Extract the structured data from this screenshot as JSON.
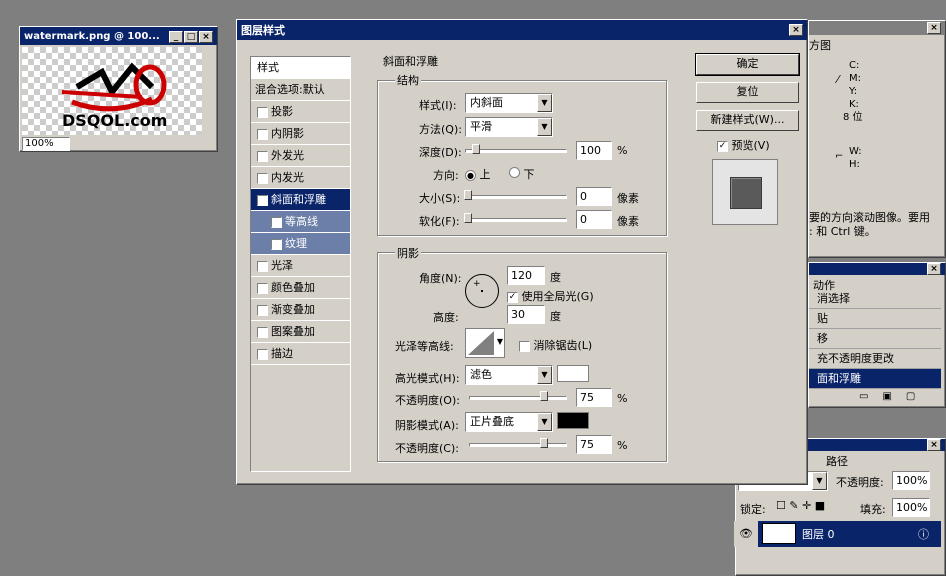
{
  "doc_window": {
    "title": "watermark.png @ 100...",
    "logo_text": "DSQOL.com",
    "zoom": "100%"
  },
  "dialog": {
    "title": "图层样式",
    "styles_header": "样式",
    "blend_options": "混合选项:默认",
    "styles": [
      {
        "label": "投影",
        "checked": false
      },
      {
        "label": "内阴影",
        "checked": false
      },
      {
        "label": "外发光",
        "checked": false
      },
      {
        "label": "内发光",
        "checked": false
      },
      {
        "label": "斜面和浮雕",
        "checked": true
      },
      {
        "label": "等高线",
        "checked": false
      },
      {
        "label": "纹理",
        "checked": false
      },
      {
        "label": "光泽",
        "checked": false
      },
      {
        "label": "颜色叠加",
        "checked": false
      },
      {
        "label": "渐变叠加",
        "checked": false
      },
      {
        "label": "图案叠加",
        "checked": false
      },
      {
        "label": "描边",
        "checked": false
      }
    ],
    "section_title": "斜面和浮雕",
    "structure": {
      "title": "结构",
      "style_label": "样式(I):",
      "style_value": "内斜面",
      "technique_label": "方法(Q):",
      "technique_value": "平滑",
      "depth_label": "深度(D):",
      "depth_value": "100",
      "depth_unit": "%",
      "direction_label": "方向:",
      "direction_up": "上",
      "direction_down": "下",
      "size_label": "大小(S):",
      "size_value": "0",
      "size_unit": "像素",
      "soften_label": "软化(F):",
      "soften_value": "0",
      "soften_unit": "像素"
    },
    "shading": {
      "title": "阴影",
      "angle_label": "角度(N):",
      "angle_value": "120",
      "angle_unit": "度",
      "global_light_label": "使用全局光(G)",
      "altitude_label": "高度:",
      "altitude_value": "30",
      "altitude_unit": "度",
      "gloss_label": "光泽等高线:",
      "antialias_label": "消除锯齿(L)",
      "highlight_label": "高光模式(H):",
      "highlight_value": "滤色",
      "highlight_color": "#ffffff",
      "hl_opacity_label": "不透明度(O):",
      "hl_opacity_value": "75",
      "pct": "%",
      "shadow_label": "阴影模式(A):",
      "shadow_value": "正片叠底",
      "shadow_color": "#000000",
      "sh_opacity_label": "不透明度(C):",
      "sh_opacity_value": "75"
    },
    "buttons": {
      "ok": "确定",
      "reset": "复位",
      "new_style": "新建样式(W)...",
      "preview": "预览(V)"
    }
  },
  "info_panel": {
    "tab": "方图",
    "labels": [
      "C:",
      "M:",
      "Y:",
      "K:"
    ],
    "bit": "8 位",
    "w": "W:",
    "h": "H:",
    "help_line1": "要的方向滚动图像。要用",
    "help_line2": ": 和 Ctrl 键。"
  },
  "history_panel": {
    "tab": "动作",
    "items": [
      "消选择",
      "贴",
      "移",
      "充不透明度更改",
      "面和浮雕"
    ]
  },
  "layers_panel": {
    "tab": "路径",
    "opacity_label": "不透明度:",
    "opacity_value": "100%",
    "lock_label": "锁定:",
    "fill_label": "填充:",
    "fill_value": "100%",
    "layer_name": "图层 0"
  }
}
